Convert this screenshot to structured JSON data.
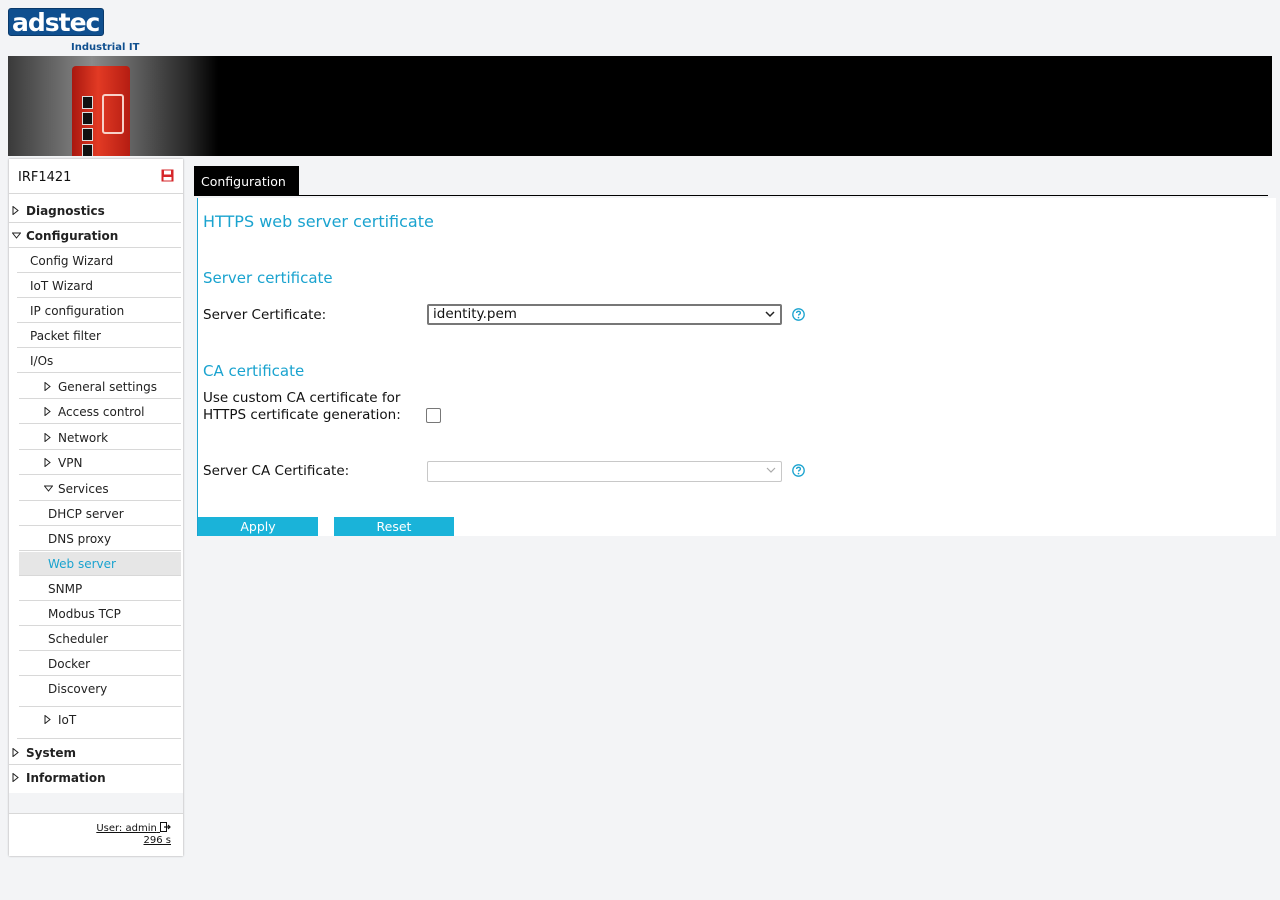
{
  "brand": {
    "logo_text": "adstec",
    "tagline": "Industrial IT"
  },
  "device": {
    "name": "IRF1421"
  },
  "sidebar": {
    "items": {
      "diagnostics": "Diagnostics",
      "configuration": "Configuration",
      "config_wizard": "Config Wizard",
      "iot_wizard": "IoT Wizard",
      "ip_configuration": "IP configuration",
      "packet_filter": "Packet filter",
      "ios": "I/Os",
      "general_settings": "General settings",
      "access_control": "Access control",
      "network": "Network",
      "vpn": "VPN",
      "services": "Services",
      "dhcp_server": "DHCP server",
      "dns_proxy": "DNS proxy",
      "web_server": "Web server",
      "snmp": "SNMP",
      "modbus_tcp": "Modbus TCP",
      "scheduler": "Scheduler",
      "docker": "Docker",
      "discovery": "Discovery",
      "iot": "IoT",
      "system": "System",
      "information": "Information"
    },
    "user_label": "User: admin",
    "session_timer": "296 s"
  },
  "tabs": {
    "active": "Configuration"
  },
  "content": {
    "title": "HTTPS web server certificate",
    "server_section": "Server certificate",
    "server_cert_label": "Server Certificate:",
    "server_cert_value": "identity.pem",
    "ca_section": "CA certificate",
    "use_custom_ca_label": "Use custom CA certificate for HTTPS certificate generation:",
    "use_custom_ca_checked": false,
    "server_ca_label": "Server CA Certificate:",
    "server_ca_value": "",
    "apply_label": "Apply",
    "reset_label": "Reset"
  },
  "colors": {
    "accent": "#1aa3cf",
    "button": "#1ab3d9",
    "brand_blue": "#0f4f8f",
    "device_red": "#e23a24"
  }
}
